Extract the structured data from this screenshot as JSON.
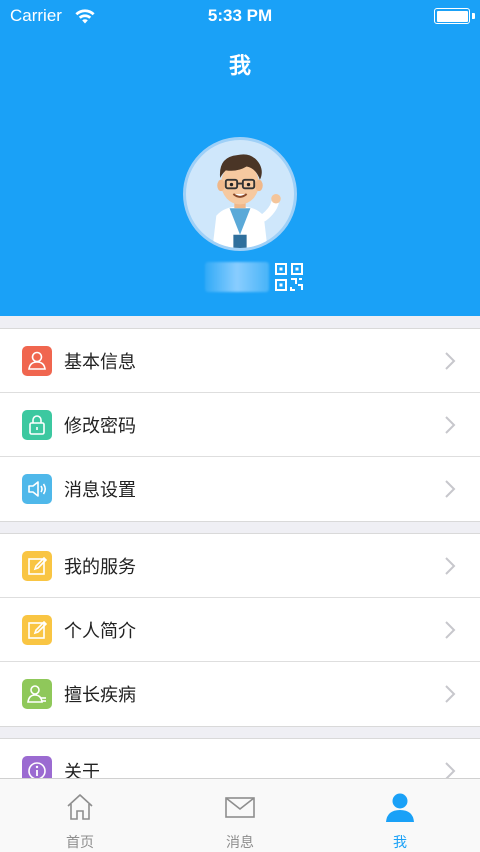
{
  "status_bar": {
    "carrier": "Carrier",
    "time": "5:33 PM"
  },
  "header": {
    "title": "我"
  },
  "menu_groups": [
    {
      "items": [
        {
          "label": "基本信息",
          "icon": "user-card-icon",
          "color": "#f0664f"
        },
        {
          "label": "修改密码",
          "icon": "lock-icon",
          "color": "#3cc8a0"
        },
        {
          "label": "消息设置",
          "icon": "speaker-icon",
          "color": "#4fb8ea"
        }
      ]
    },
    {
      "items": [
        {
          "label": "我的服务",
          "icon": "edit-icon",
          "color": "#f9c543"
        },
        {
          "label": "个人简介",
          "icon": "edit-icon",
          "color": "#f9c543"
        },
        {
          "label": "擅长疾病",
          "icon": "user-card-icon",
          "color": "#8fc85a"
        }
      ]
    },
    {
      "items": [
        {
          "label": "关于",
          "icon": "info-icon",
          "color": "#9b6bd1"
        }
      ]
    }
  ],
  "tabbar": {
    "tabs": [
      {
        "label": "首页",
        "icon": "home-icon"
      },
      {
        "label": "消息",
        "icon": "mail-icon"
      },
      {
        "label": "我",
        "icon": "person-icon",
        "active": true
      }
    ]
  },
  "colors": {
    "primary": "#1aa1f7",
    "background": "#efeff4"
  }
}
